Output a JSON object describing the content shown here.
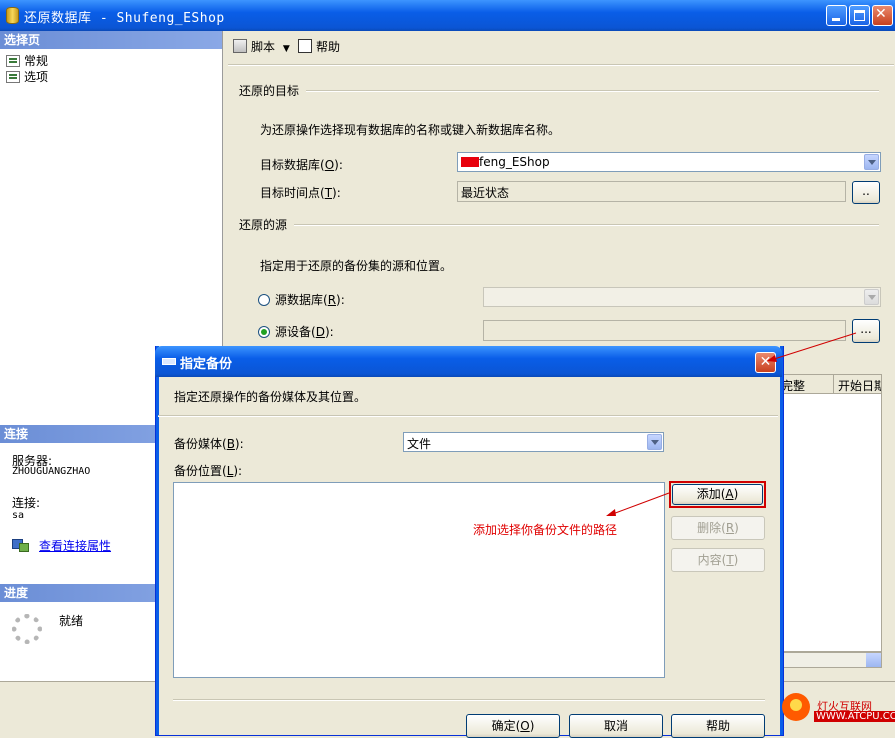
{
  "window": {
    "title": "还原数据库 - Shufeng_EShop"
  },
  "left_panel": {
    "select_page_header": "选择页",
    "pages": [
      "常规",
      "选项"
    ],
    "connection_header": "连接",
    "server_label": "服务器:",
    "server_value": "ZHOUGUANGZHAO",
    "connection_label": "连接:",
    "connection_value": "sa",
    "view_connection_link": "查看连接属性",
    "progress_header": "进度",
    "progress_status": "就绪"
  },
  "toolbar": {
    "script_label": "脚本",
    "help_label": "帮助"
  },
  "restore_target": {
    "section_title": "还原的目标",
    "description": "为还原操作选择现有数据库的名称或键入新数据库名称。",
    "target_db_label": "目标数据库(",
    "target_db_key": "O",
    "target_db_value": "feng_EShop",
    "target_time_label": "目标时间点(",
    "target_time_key": "T",
    "target_time_value": "最近状态",
    "browse_label": ".."
  },
  "restore_source": {
    "section_title": "还原的源",
    "description": "指定用于还原的备份集的源和位置。",
    "source_db_label": "源数据库(",
    "source_db_key": "R",
    "source_device_label": "源设备(",
    "source_device_key": "D",
    "selected": "source_device",
    "browse_label": "..."
  },
  "backup_grid": {
    "col_complete_lsn": "完整 LSN",
    "col_start": "开始日期"
  },
  "dialog": {
    "title": "指定备份",
    "description": "指定还原操作的备份媒体及其位置。",
    "media_label": "备份媒体(",
    "media_key": "B",
    "media_value": "文件",
    "location_label": "备份位置(",
    "location_key": "L",
    "add_button": "添加(",
    "add_key": "A",
    "remove_button": "删除(",
    "remove_key": "R",
    "contents_button": "内容(",
    "contents_key": "T",
    "ok_button": "确定(",
    "ok_key": "O",
    "cancel_button": "取消",
    "help_button": "帮助",
    "close_glyph": "✕"
  },
  "annotation": {
    "text": "添加选择你备份文件的路径",
    "color": "#e00000"
  },
  "watermark": {
    "line1": "灯火互联网",
    "line2": "WWW.ATCPU.COM"
  }
}
